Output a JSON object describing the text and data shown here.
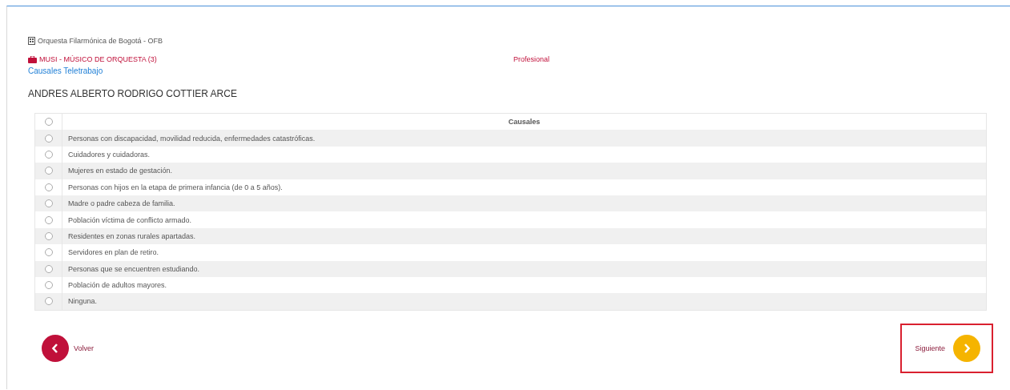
{
  "entity": "Orquesta Filarmónica de Bogotá - OFB",
  "position": "MUSI - MÚSICO DE ORQUESTA (3)",
  "level": "Profesional",
  "link": "Causales Teletrabajo",
  "person": "ANDRES ALBERTO RODRIGO COTTIER ARCE",
  "table": {
    "header": "Causales",
    "header_checked": false,
    "rows": [
      {
        "text": "Personas con discapacidad, movilidad reducida, enfermedades catastróficas.",
        "checked": false
      },
      {
        "text": "Cuidadores y cuidadoras.",
        "checked": false
      },
      {
        "text": "Mujeres en estado de gestación.",
        "checked": false
      },
      {
        "text": "Personas con hijos en la etapa de primera infancia (de 0 a 5 años).",
        "checked": false
      },
      {
        "text": "Madre o padre cabeza de familia.",
        "checked": false
      },
      {
        "text": "Población víctima de conflicto armado.",
        "checked": false
      },
      {
        "text": "Residentes en zonas rurales apartadas.",
        "checked": false
      },
      {
        "text": "Servidores en plan de retiro.",
        "checked": false
      },
      {
        "text": "Personas que se encuentren estudiando.",
        "checked": false
      },
      {
        "text": "Población de adultos mayores.",
        "checked": false
      },
      {
        "text": "Ninguna.",
        "checked": false
      }
    ]
  },
  "back": "Volver",
  "next": "Siguiente"
}
